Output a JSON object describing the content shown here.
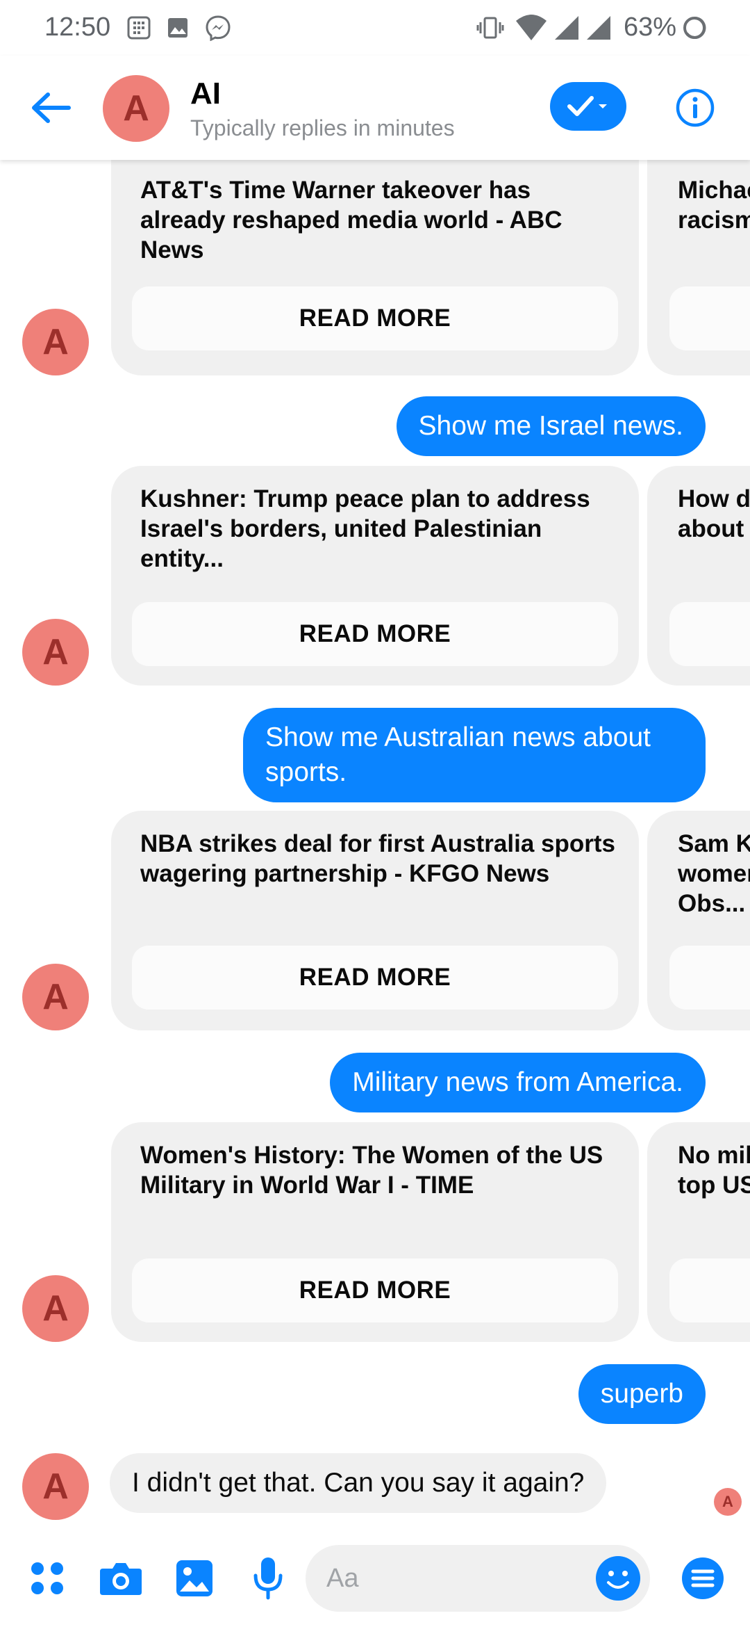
{
  "status_bar": {
    "time": "12:50",
    "battery": "63%",
    "icons": [
      "calculator-icon",
      "gallery-icon",
      "messenger-icon",
      "vibrate-icon",
      "wifi-icon",
      "signal-icon",
      "signal-icon",
      "battery-icon"
    ]
  },
  "header": {
    "avatar_letter": "A",
    "name": "AI",
    "subtitle": "Typically replies in minutes"
  },
  "messages": {
    "card1": {
      "title": "AT&T's Time Warner takeover has already reshaped media world - ABC News",
      "button": "READ MORE",
      "peek": "Michael\nracism"
    },
    "user1": "Show me Israel news.",
    "card2": {
      "title": "Kushner: Trump peace plan to address Israel's borders, united Palestinian entity...",
      "button": "READ MORE",
      "peek": "How do\nabout"
    },
    "user2": "Show me Australian news about sports.",
    "card3": {
      "title": "NBA strikes deal for first Australia sports wagering partnership - KFGO News",
      "button": "READ MORE",
      "peek": "Sam K\nwomen\nObs..."
    },
    "user3": "Military news from America.",
    "card4": {
      "title": "Women's History: The Women of the US Military in World War I - TIME",
      "button": "READ MORE",
      "peek": "No mil\ntop US"
    },
    "user4": "superb",
    "bot_reply": "I didn't get that. Can you say it again?",
    "avatar_letter": "A",
    "receipt_letter": "A"
  },
  "composer": {
    "placeholder": "Aa"
  },
  "colors": {
    "accent": "#0a84ff",
    "avatar_bg": "#ef8079",
    "avatar_fg": "#9c2f2b",
    "bubble_in": "#f0f0f0"
  }
}
